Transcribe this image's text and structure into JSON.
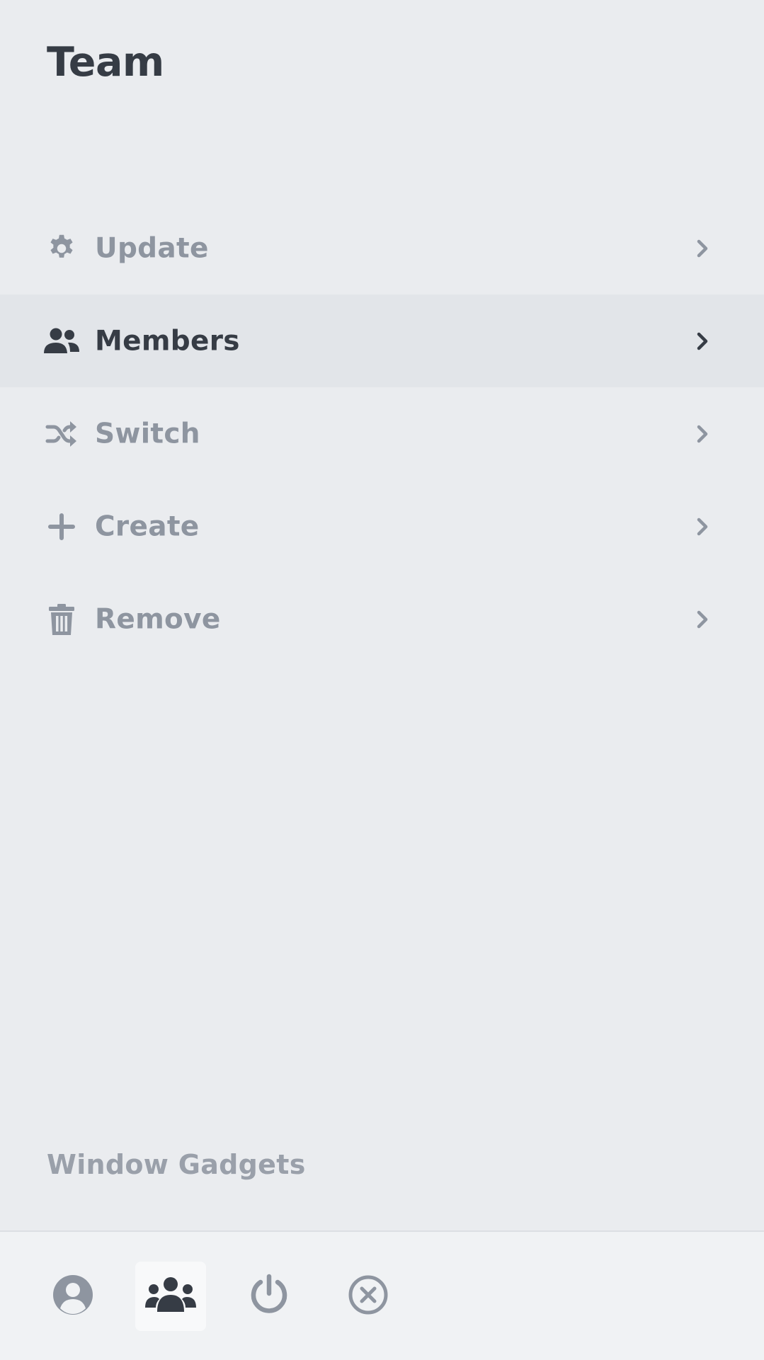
{
  "header": {
    "title": "Team"
  },
  "menu": {
    "items": [
      {
        "label": "Update",
        "icon": "gear-icon",
        "active": false
      },
      {
        "label": "Members",
        "icon": "users-icon",
        "active": true
      },
      {
        "label": "Switch",
        "icon": "shuffle-icon",
        "active": false
      },
      {
        "label": "Create",
        "icon": "plus-icon",
        "active": false
      },
      {
        "label": "Remove",
        "icon": "trash-icon",
        "active": false
      }
    ]
  },
  "footer": {
    "section_label": "Window Gadgets"
  },
  "bottom_bar": {
    "buttons": [
      {
        "icon": "user-circle-icon",
        "active": false
      },
      {
        "icon": "users-icon",
        "active": true
      },
      {
        "icon": "power-icon",
        "active": false
      },
      {
        "icon": "close-circle-icon",
        "active": false
      }
    ]
  },
  "colors": {
    "background": "#eaecef",
    "active_row": "#e2e5e9",
    "text_dark": "#363c45",
    "text_muted": "#8e95a0",
    "bottom_bar": "#f0f2f4"
  }
}
